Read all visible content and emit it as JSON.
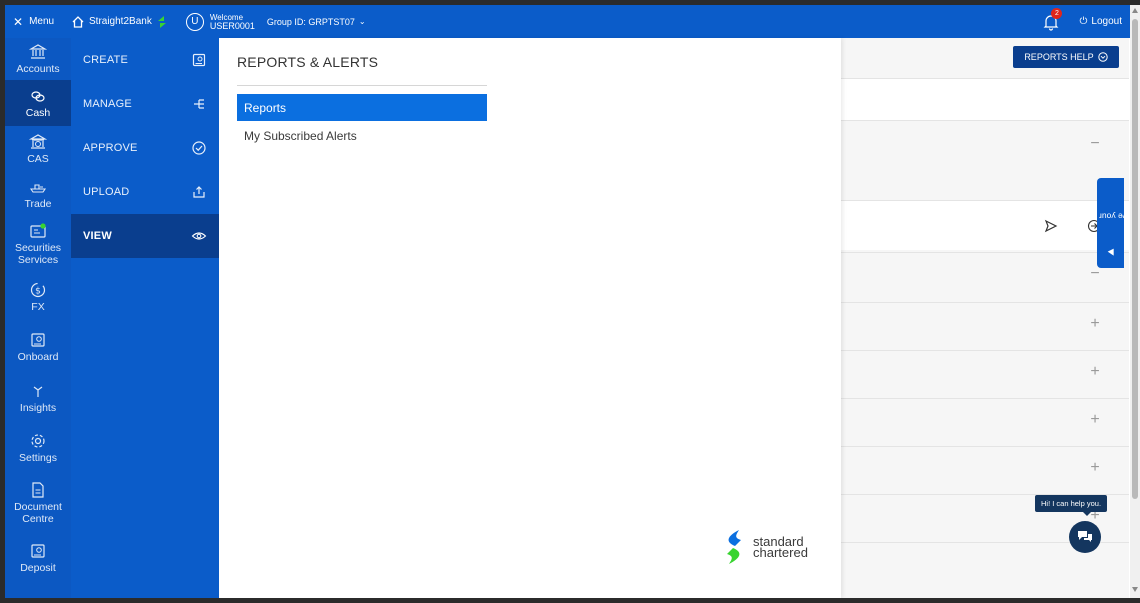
{
  "topbar": {
    "menu_label": "Menu",
    "brand_name": "Straight2Bank",
    "user_initial": "U",
    "welcome": "Welcome",
    "username": "USER0001",
    "group_id": "Group ID: GRPTST07",
    "notification_count": "2",
    "logout_label": "Logout"
  },
  "rail": {
    "items": [
      {
        "label": "Accounts",
        "icon": "bank-icon"
      },
      {
        "label": "Cash",
        "icon": "coins-icon",
        "active": true
      },
      {
        "label": "CAS",
        "icon": "institution-icon"
      },
      {
        "label": "Trade",
        "icon": "ship-icon"
      },
      {
        "label": "Securities Services",
        "icon": "id-card-icon"
      },
      {
        "label": "FX",
        "icon": "currency-icon"
      },
      {
        "label": "Onboard",
        "icon": "document-search-icon"
      },
      {
        "label": "Insights",
        "icon": "antenna-icon"
      },
      {
        "label": "Settings",
        "icon": "gear-icon"
      },
      {
        "label": "Document Centre",
        "icon": "document-icon"
      },
      {
        "label": "Deposit",
        "icon": "document-search-icon"
      }
    ]
  },
  "subnav": {
    "items": [
      {
        "label": "CREATE",
        "icon": "document-add-icon"
      },
      {
        "label": "MANAGE",
        "icon": "hierarchy-icon"
      },
      {
        "label": "APPROVE",
        "icon": "check-circle-icon"
      },
      {
        "label": "UPLOAD",
        "icon": "upload-icon"
      },
      {
        "label": "VIEW",
        "icon": "eye-icon",
        "active": true
      }
    ]
  },
  "panel": {
    "title": "REPORTS & ALERTS",
    "links": [
      {
        "label": "Reports",
        "selected": true
      },
      {
        "label": "My Subscribed Alerts",
        "selected": false
      }
    ],
    "logo_line1": "standard",
    "logo_line2": "chartered"
  },
  "content": {
    "reports_help_label": "REPORTS HELP",
    "row_toggles": [
      "−",
      "−",
      "+",
      "+",
      "+",
      "+",
      "+"
    ]
  },
  "feedback_tab": "Have your say",
  "chat_tip": "Hi! I can help you.",
  "colors": {
    "primary_blue": "#0b5cc9",
    "active_blue": "#0a3e8e",
    "selected_link": "#0b6fe0",
    "badge_red": "#e0261b",
    "chat_navy": "#14365f",
    "sc_green": "#38d430"
  }
}
